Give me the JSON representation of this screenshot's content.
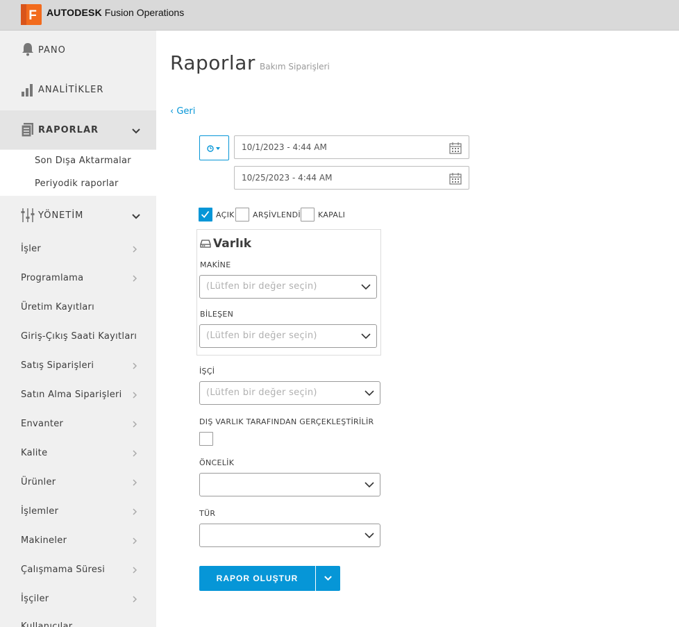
{
  "app": {
    "brand_bold": "AUTODESK",
    "brand_rest": "Fusion Operations",
    "logo_letter": "F",
    "accent": "#0696d7",
    "logo_color": "#f26b1d"
  },
  "sidebar": {
    "top_items": [
      {
        "label": "PANO",
        "icon": "bell-icon"
      },
      {
        "label": "ANALİTİKLER",
        "icon": "bar-chart-icon"
      },
      {
        "label": "RAPORLAR",
        "icon": "report-icon",
        "expanded": true
      },
      {
        "label": "YÖNETİM",
        "icon": "sliders-icon",
        "expanded": true
      }
    ],
    "report_subitems": [
      "Son Dışa Aktarmalar",
      "Periyodik raporlar"
    ],
    "items": [
      {
        "label": "İşler",
        "chevron": true
      },
      {
        "label": "Programlama",
        "chevron": true
      },
      {
        "label": "Üretim Kayıtları",
        "chevron": false
      },
      {
        "label": "Giriş-Çıkış Saati Kayıtları",
        "chevron": false
      },
      {
        "label": "Satış Siparişleri",
        "chevron": true
      },
      {
        "label": "Satın Alma Siparişleri",
        "chevron": true
      },
      {
        "label": "Envanter",
        "chevron": true
      },
      {
        "label": "Kalite",
        "chevron": true
      },
      {
        "label": "Ürünler",
        "chevron": true
      },
      {
        "label": "İşlemler",
        "chevron": true
      },
      {
        "label": "Makineler",
        "chevron": true
      },
      {
        "label": "Çalışmama Süresi",
        "chevron": true
      },
      {
        "label": "İşçiler",
        "chevron": true
      },
      {
        "label": "Kullanıcılar",
        "chevron": false
      }
    ]
  },
  "main": {
    "title": "Raporlar",
    "subtitle": "Bakım Siparişleri",
    "back_label": "‹ Geri",
    "date_from": "10/1/2023 - 4:44 AM",
    "date_to": "10/25/2023 - 4:44 AM",
    "status_filters": [
      {
        "label": "AÇIK",
        "checked": true
      },
      {
        "label": "ARŞİVLENDİ",
        "checked": false
      },
      {
        "label": "KAPALI",
        "checked": false
      }
    ],
    "asset_panel": {
      "title": "Varlık",
      "machine_label": "MAKİNE",
      "machine_placeholder": "(Lütfen bir değer seçin)",
      "component_label": "BİLEŞEN",
      "component_placeholder": "(Lütfen bir değer seçin)"
    },
    "worker_label": "İŞÇİ",
    "worker_placeholder": "(Lütfen bir değer seçin)",
    "external_label": "DIŞ VARLIK TARAFINDAN GERÇEKLEŞTİRİLİR",
    "external_checked": false,
    "priority_label": "ÖNCELİK",
    "priority_value": "",
    "type_label": "TÜR",
    "type_value": "",
    "create_button": "RAPOR OLUŞTUR"
  }
}
